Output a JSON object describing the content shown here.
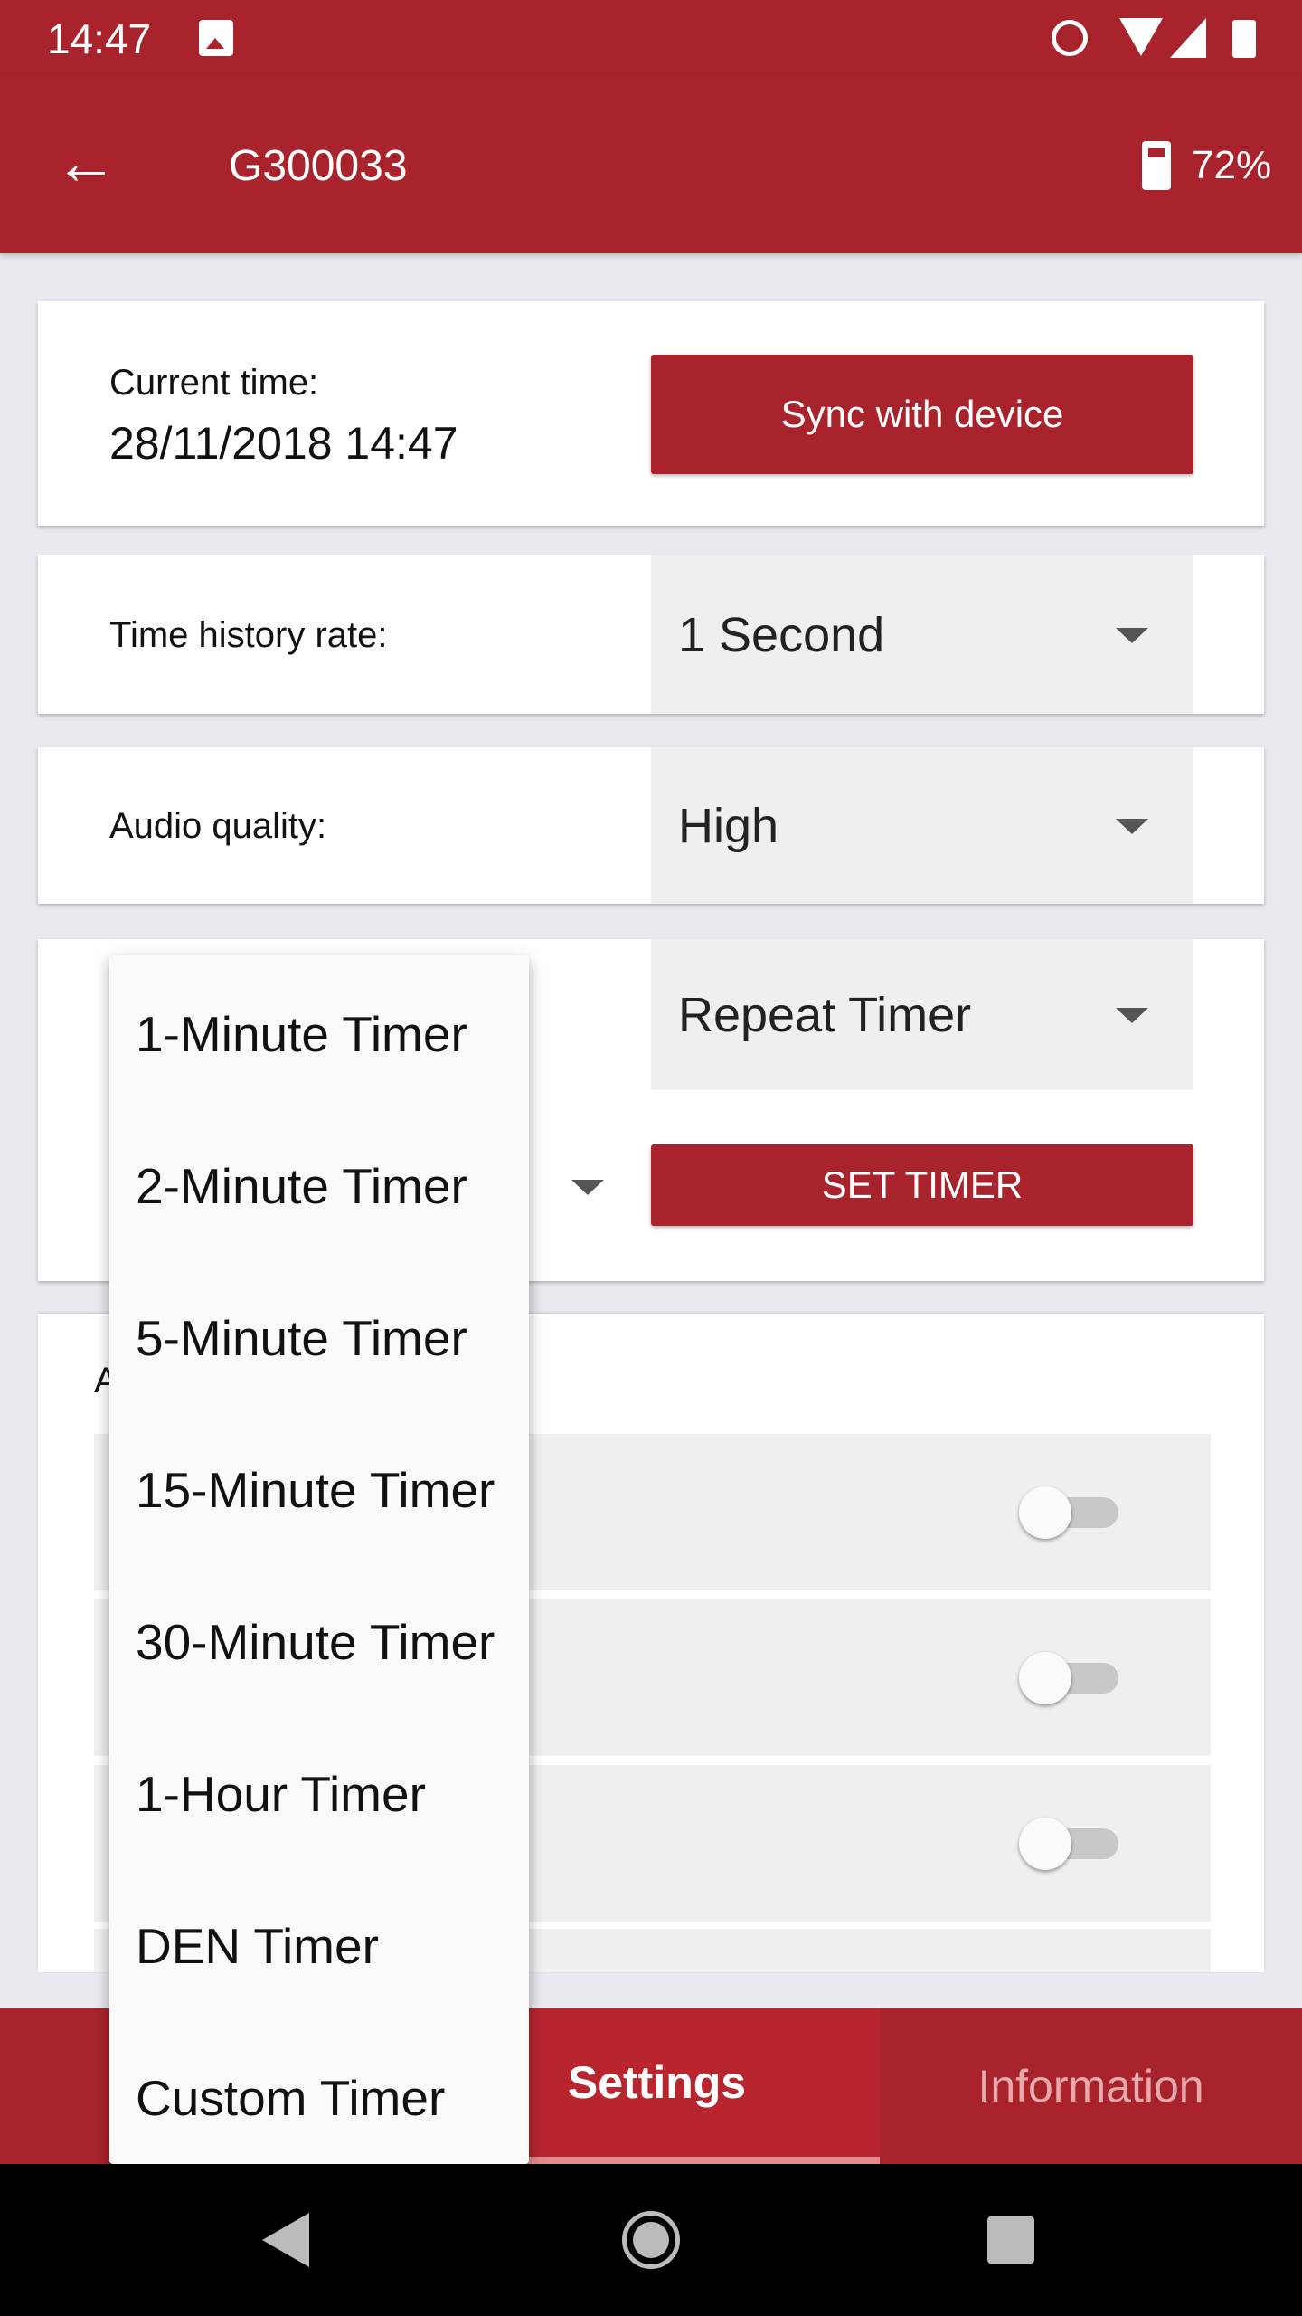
{
  "status_bar": {
    "time": "14:47",
    "icons": [
      "image-icon",
      "alarm-icon",
      "wifi-icon",
      "signal-icon",
      "battery-icon"
    ]
  },
  "app_bar": {
    "title": "G300033",
    "battery_percent": "72%",
    "back_icon": "arrow-left-icon"
  },
  "current_time": {
    "label": "Current time:",
    "value": "28/11/2018 14:47",
    "button": "Sync with device"
  },
  "history_rate": {
    "label": "Time history rate:",
    "value": "1 Second"
  },
  "audio_quality": {
    "label": "Audio quality:",
    "value": "High"
  },
  "timer": {
    "mode": "Repeat Timer",
    "button": "SET TIMER"
  },
  "alarm_card": {
    "title_partial": "A",
    "toggles": [
      false,
      false,
      false
    ]
  },
  "menu": {
    "items": [
      "1-Minute Timer",
      "2-Minute Timer",
      "5-Minute Timer",
      "15-Minute Timer",
      "30-Minute Timer",
      "1-Hour Timer",
      "DEN Timer",
      "Custom Timer"
    ]
  },
  "bottom_nav": {
    "tabs": [
      {
        "label": "Settings",
        "active": true
      },
      {
        "label": "Information",
        "active": false
      }
    ]
  },
  "colors": {
    "primary": "#a8232c",
    "active_tab": "#b8252e"
  }
}
